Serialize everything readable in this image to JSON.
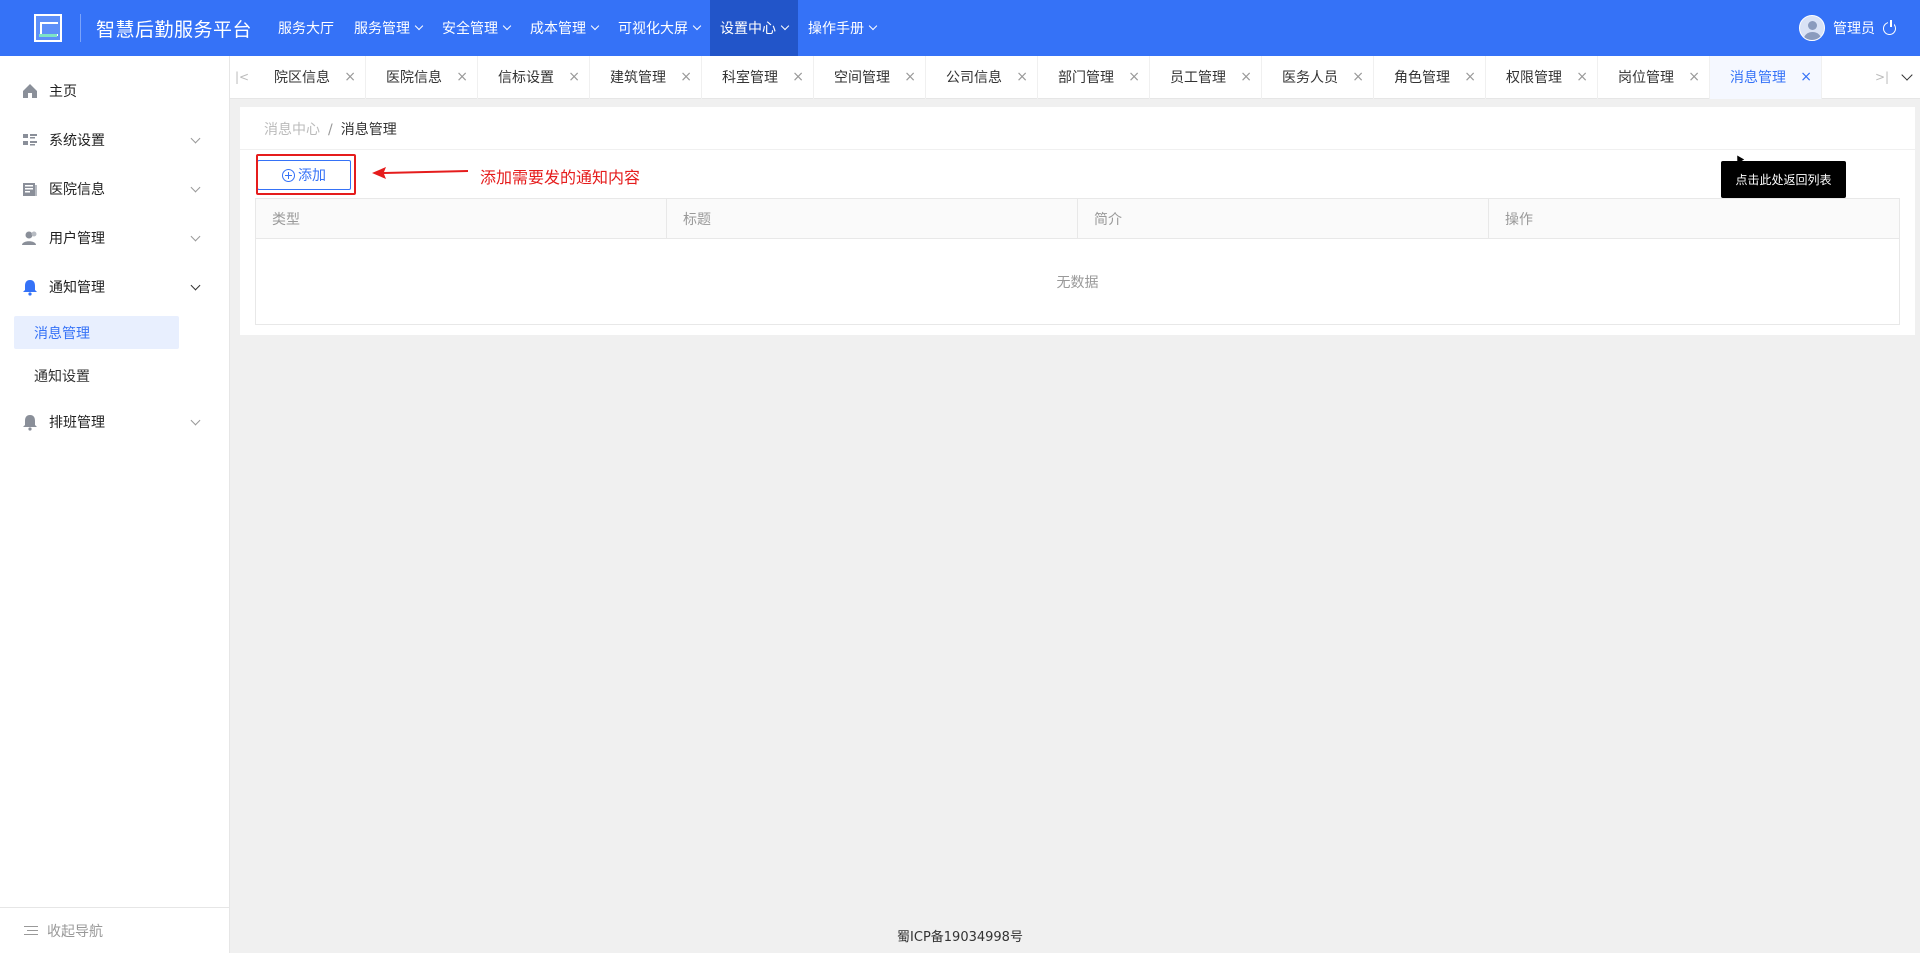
{
  "app": {
    "title": "智慧后勤服务平台"
  },
  "nav": {
    "items": [
      {
        "label": "服务大厅",
        "dropdown": false,
        "active": false
      },
      {
        "label": "服务管理",
        "dropdown": true,
        "active": false
      },
      {
        "label": "安全管理",
        "dropdown": true,
        "active": false
      },
      {
        "label": "成本管理",
        "dropdown": true,
        "active": false
      },
      {
        "label": "可视化大屏",
        "dropdown": true,
        "active": false
      },
      {
        "label": "设置中心",
        "dropdown": true,
        "active": true
      },
      {
        "label": "操作手册",
        "dropdown": true,
        "active": false
      }
    ]
  },
  "user": {
    "name": "管理员"
  },
  "sidebar": {
    "home": "主页",
    "system": "系统设置",
    "hospital": "医院信息",
    "users": "用户管理",
    "notify": "通知管理",
    "notify_sub": [
      "消息管理",
      "通知设置"
    ],
    "schedule": "排班管理",
    "collapse": "收起导航"
  },
  "tabs": {
    "items": [
      "院区信息",
      "医院信息",
      "信标设置",
      "建筑管理",
      "科室管理",
      "空间管理",
      "公司信息",
      "部门管理",
      "员工管理",
      "医务人员",
      "角色管理",
      "权限管理",
      "岗位管理",
      "消息管理"
    ],
    "active": "消息管理",
    "close": "×",
    "first": "|<",
    "last": ">|"
  },
  "breadcrumb": {
    "parent": "消息中心",
    "separator": "/",
    "current": "消息管理"
  },
  "toolbar": {
    "add_label": "添加"
  },
  "annotation": "添加需要发的通知内容",
  "tooltip": "点击此处返回列表",
  "table": {
    "columns": [
      "类型",
      "标题",
      "简介",
      "操作"
    ],
    "empty_text": "无数据"
  },
  "footer": "蜀ICP备19034998号",
  "colors": {
    "primary": "#3572f7",
    "annotation_red": "#e51c1c",
    "active_nav": "#2255c9"
  }
}
